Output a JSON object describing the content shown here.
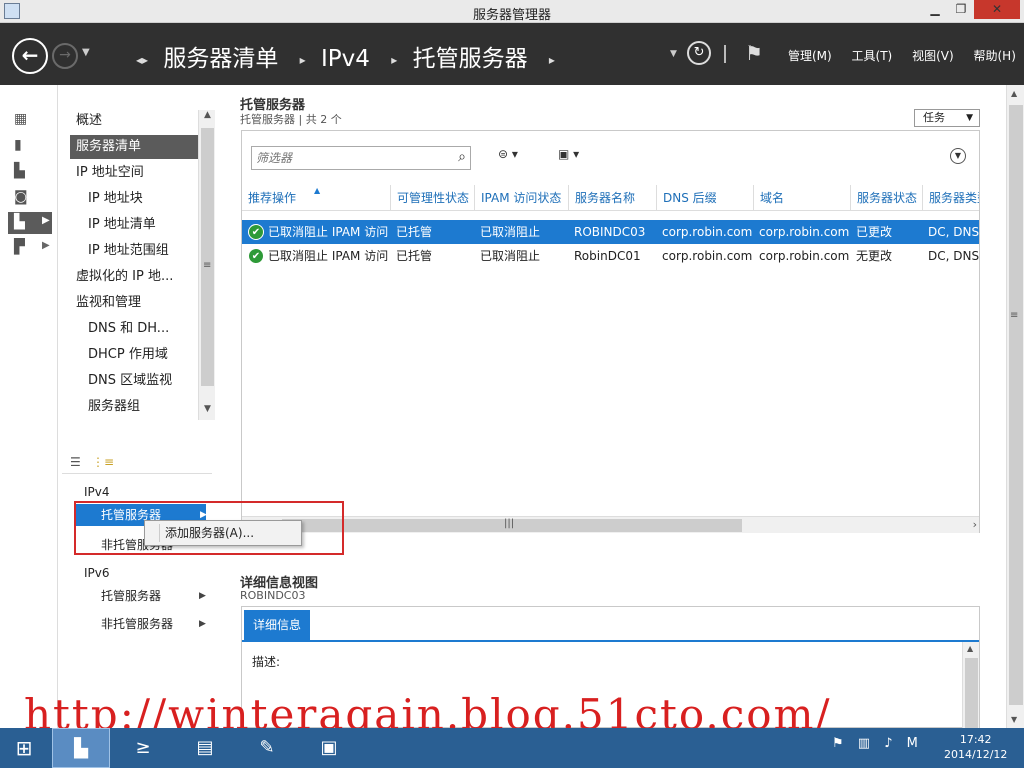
{
  "window": {
    "title": "服务器管理器",
    "min": "▁",
    "max": "❐",
    "close": "✕"
  },
  "header": {
    "back": "←",
    "forward": "→",
    "dropdown": "▼",
    "breadcrumb": [
      "服务器清单",
      "IPv4",
      "托管服务器"
    ],
    "crumb_sep": "▸",
    "refresh": "↻",
    "menus": [
      "管理(M)",
      "工具(T)",
      "视图(V)",
      "帮助(H)"
    ]
  },
  "nav": {
    "items": [
      {
        "label": "概述",
        "sub": false
      },
      {
        "label": "服务器清单",
        "sub": false,
        "selected": true
      },
      {
        "label": "IP 地址空间",
        "sub": false
      },
      {
        "label": "IP 地址块",
        "sub": true
      },
      {
        "label": "IP 地址清单",
        "sub": true
      },
      {
        "label": "IP 地址范围组",
        "sub": true
      },
      {
        "label": "虚拟化的 IP 地...",
        "sub": false
      },
      {
        "label": "监视和管理",
        "sub": false
      },
      {
        "label": "DNS 和 DH...",
        "sub": true
      },
      {
        "label": "DHCP 作用域",
        "sub": true
      },
      {
        "label": "DNS 区域监视",
        "sub": true
      },
      {
        "label": "服务器组",
        "sub": true
      }
    ],
    "tree": {
      "ipv4": "IPv4",
      "ipv4_hosted": "托管服务器",
      "ipv4_unhosted": "非托管服务器",
      "ipv6": "IPv6",
      "ipv6_hosted": "托管服务器",
      "ipv6_unhosted": "非托管服务器"
    }
  },
  "context_menu": {
    "add_server": "添加服务器(A)..."
  },
  "hosted": {
    "title": "托管服务器",
    "subtitle": "托管服务器 | 共 2 个",
    "tasks": "任务",
    "filter_placeholder": "筛选器",
    "columns": [
      "推荐操作",
      "可管理性状态",
      "IPAM 访问状态",
      "服务器名称",
      "DNS 后缀",
      "域名",
      "服务器状态",
      "服务器类型"
    ],
    "rows": [
      [
        "已取消阻止 IPAM 访问",
        "已托管",
        "已取消阻止",
        "ROBINDC03",
        "corp.robin.com",
        "corp.robin.com",
        "已更改",
        "DC, DNS"
      ],
      [
        "已取消阻止 IPAM 访问",
        "已托管",
        "已取消阻止",
        "RobinDC01",
        "corp.robin.com",
        "corp.robin.com",
        "无更改",
        "DC, DNS"
      ]
    ]
  },
  "details": {
    "title": "详细信息视图",
    "subtitle": "ROBINDC03",
    "tab": "详细信息",
    "desc_label": "描述:"
  },
  "watermark": "http://winteragain.blog.51cto.com/",
  "taskbar": {
    "time": "17:42",
    "date": "2014/12/12",
    "ime": "M"
  },
  "colors": {
    "accent": "#1d7ad0",
    "header": "#303030",
    "taskbar": "#2a5f93",
    "annotation": "#d42a2a",
    "ok": "#2e9a38"
  }
}
